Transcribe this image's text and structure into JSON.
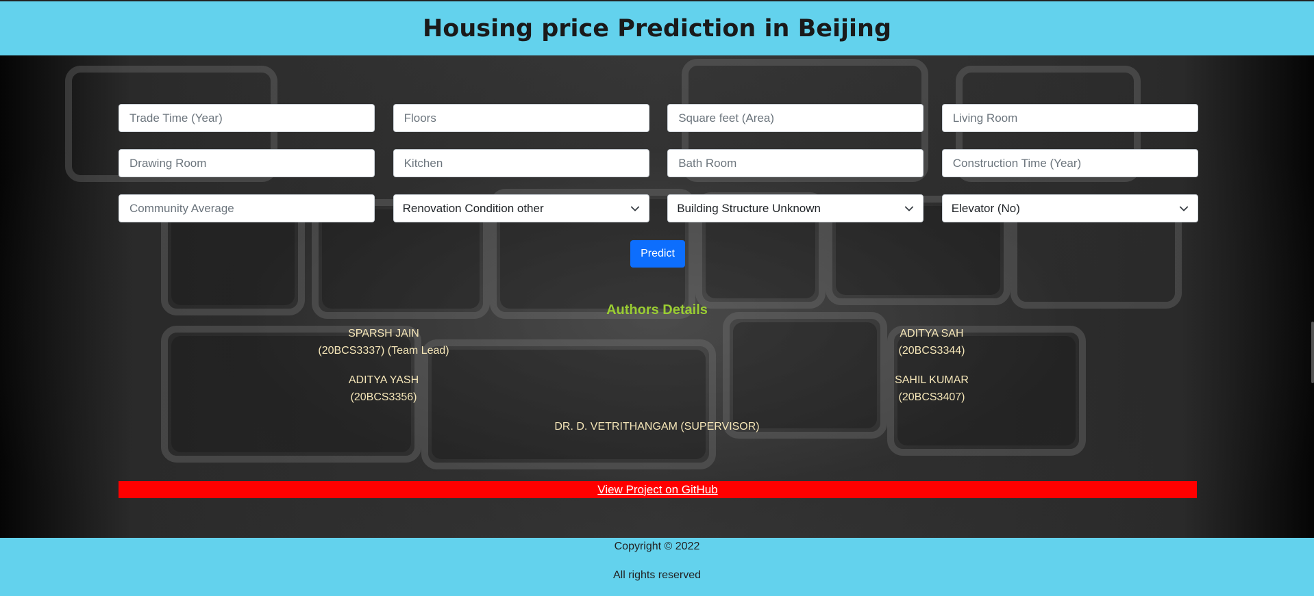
{
  "header": {
    "title": "Housing price Prediction in Beijing"
  },
  "form": {
    "inputs": [
      {
        "placeholder": "Trade Time (Year)"
      },
      {
        "placeholder": "Floors"
      },
      {
        "placeholder": "Square feet (Area)"
      },
      {
        "placeholder": "Living Room"
      },
      {
        "placeholder": "Drawing Room"
      },
      {
        "placeholder": "Kitchen"
      },
      {
        "placeholder": "Bath Room"
      },
      {
        "placeholder": "Construction Time (Year)"
      },
      {
        "placeholder": "Community Average"
      }
    ],
    "selects": [
      {
        "value": "Renovation Condition other"
      },
      {
        "value": "Building Structure Unknown"
      },
      {
        "value": "Elevator (No)"
      }
    ],
    "predict_label": "Predict"
  },
  "authors": {
    "title": "Authors Details",
    "left": [
      {
        "name": "SPARSH JAIN",
        "detail": "(20BCS3337) (Team Lead)"
      },
      {
        "name": "ADITYA YASH",
        "detail": "(20BCS3356)"
      }
    ],
    "right": [
      {
        "name": "ADITYA SAH",
        "detail": "(20BCS3344)"
      },
      {
        "name": "SAHIL KUMAR",
        "detail": "(20BCS3407)"
      }
    ],
    "supervisor": "DR. D. VETRITHANGAM (SUPERVISOR)"
  },
  "github": {
    "link_text": "View Project on GitHub"
  },
  "footer": {
    "copyright": "Copyright © 2022",
    "rights": "All rights reserved"
  },
  "colors": {
    "header_bg": "#63d2ed",
    "primary_button": "#0d6efd",
    "authors_title": "#9acd32",
    "github_bar": "#ff0000"
  }
}
